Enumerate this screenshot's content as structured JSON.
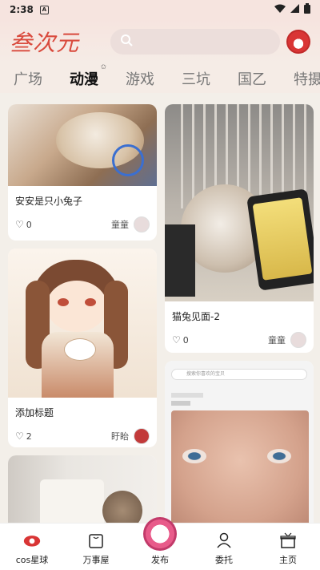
{
  "status_bar": {
    "time": "2:38",
    "notif_badge": "A"
  },
  "header": {
    "logo": "叁次元",
    "search_placeholder": ""
  },
  "tabs": [
    {
      "label": "广场"
    },
    {
      "label": "动漫",
      "active": true
    },
    {
      "label": "游戏"
    },
    {
      "label": "三坑"
    },
    {
      "label": "国乙"
    },
    {
      "label": "特摄"
    }
  ],
  "feed": {
    "left": [
      {
        "title": "安安是只小兔子",
        "likes": "0",
        "author": "童童"
      },
      {
        "title": "添加标题",
        "likes": "2",
        "author": "盱眙"
      }
    ],
    "right": [
      {
        "title": "猫兔见面-2",
        "likes": "0",
        "author": "童童"
      }
    ]
  },
  "phone_overlay": {
    "search_hint": "搜索你喜欢的宝贝"
  },
  "nav": {
    "items": [
      {
        "label": "cos星球"
      },
      {
        "label": "万事屋"
      },
      {
        "label": "发布"
      },
      {
        "label": "委托"
      },
      {
        "label": "主页"
      }
    ]
  },
  "colors": {
    "accent": "#d94a3d",
    "background": "#f3efe9"
  }
}
